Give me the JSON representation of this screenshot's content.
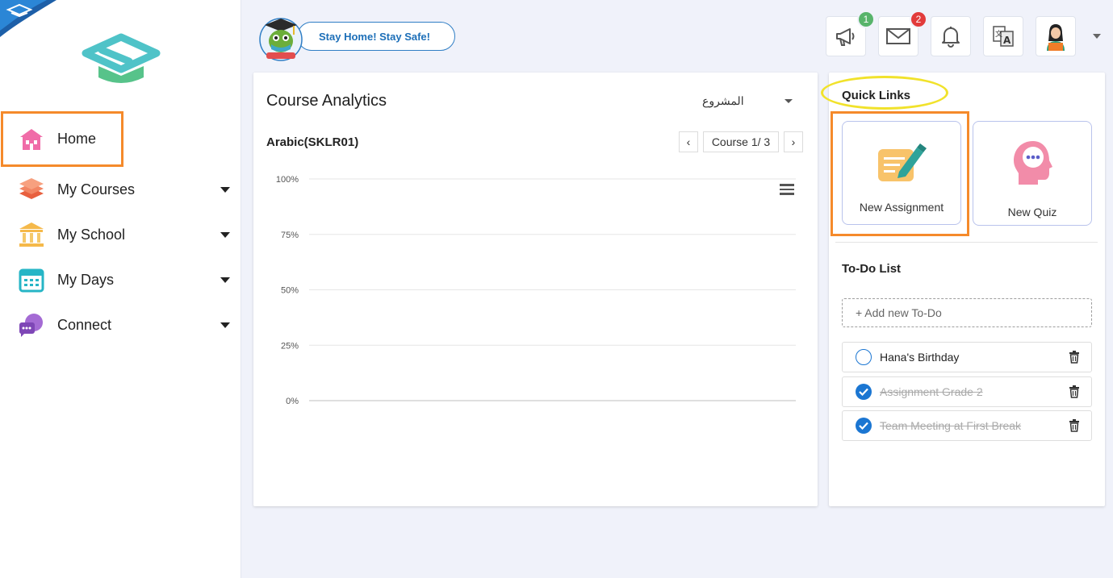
{
  "sidebar": {
    "items": [
      {
        "label": "Home",
        "has_caret": false,
        "icon": "school-building-icon"
      },
      {
        "label": "My Courses",
        "has_caret": true,
        "icon": "books-stack-icon"
      },
      {
        "label": "My School",
        "has_caret": true,
        "icon": "school-columns-icon"
      },
      {
        "label": "My Days",
        "has_caret": true,
        "icon": "calendar-icon"
      },
      {
        "label": "Connect",
        "has_caret": true,
        "icon": "chat-bubbles-icon"
      }
    ]
  },
  "header": {
    "banner_text": "Stay Home! Stay Safe!",
    "icons": [
      {
        "name": "announcement-icon",
        "badge": "1",
        "badge_color": "#58b46b"
      },
      {
        "name": "mail-icon",
        "badge": "2",
        "badge_color": "#e23b3b"
      },
      {
        "name": "bell-icon",
        "badge": null
      },
      {
        "name": "language-icon",
        "badge": null
      },
      {
        "name": "profile-avatar-icon",
        "badge": null
      }
    ]
  },
  "analytics": {
    "title": "Course Analytics",
    "project_select": "المشروع",
    "course_name": "Arabic(SKLR01)",
    "pager_label": "Course 1/ 3",
    "prev": "‹",
    "next": "›"
  },
  "chart_data": {
    "type": "line",
    "title": "",
    "xlabel": "",
    "ylabel": "",
    "y_ticks": [
      "100%",
      "75%",
      "50%",
      "25%",
      "0%"
    ],
    "ylim": [
      0,
      100
    ],
    "series": [],
    "grid": true
  },
  "quick_links": {
    "title": "Quick Links",
    "items": [
      {
        "label": "New Assignment",
        "icon": "assignment-pen-icon"
      },
      {
        "label": "New Quiz",
        "icon": "quiz-head-icon"
      }
    ]
  },
  "todo": {
    "title": "To-Do List",
    "placeholder": "+ Add new To-Do",
    "items": [
      {
        "text": "Hana's Birthday",
        "done": false
      },
      {
        "text": "Assignment Grade 2",
        "done": true
      },
      {
        "text": "Team Meeting at First Break",
        "done": true
      }
    ]
  },
  "colors": {
    "accent": "#1b76d2",
    "highlight_orange": "#f58a2b",
    "highlight_yellow": "#f1e22b",
    "logo_teal": "#4fc3c8"
  }
}
